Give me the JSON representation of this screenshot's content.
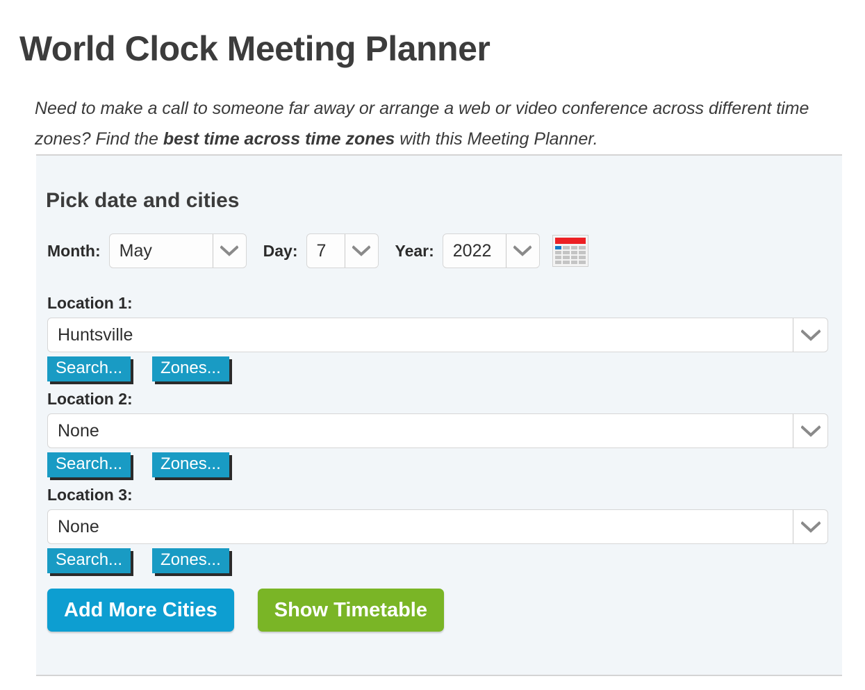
{
  "header": {
    "title": "World Clock Meeting Planner",
    "intro_part1": "Need to make a call to someone far away or arrange a web or video conference across different time zones? Find the ",
    "intro_emphasis": "best time across time zones",
    "intro_part2": " with this Meeting Planner."
  },
  "panel": {
    "heading": "Pick date and cities",
    "date": {
      "month_label": "Month:",
      "month_value": "May",
      "day_label": "Day:",
      "day_value": "7",
      "year_label": "Year:",
      "year_value": "2022",
      "calendar_icon": "calendar-icon"
    },
    "locations": [
      {
        "label": "Location 1:",
        "value": "Huntsville",
        "search_label": "Search...",
        "zones_label": "Zones..."
      },
      {
        "label": "Location 2:",
        "value": "None",
        "search_label": "Search...",
        "zones_label": "Zones..."
      },
      {
        "label": "Location 3:",
        "value": "None",
        "search_label": "Search...",
        "zones_label": "Zones..."
      }
    ],
    "actions": {
      "add_more_label": "Add More Cities",
      "show_timetable_label": "Show Timetable"
    }
  },
  "colors": {
    "accent_blue": "#0d9ed1",
    "accent_green": "#7ab526",
    "flat_button_teal": "#199bc4",
    "panel_background": "#f2f6f9",
    "calendar_red": "#ec2024",
    "calendar_selected_blue": "#1279c6"
  },
  "icons": {
    "chevron_down": "chevron-down-icon"
  }
}
